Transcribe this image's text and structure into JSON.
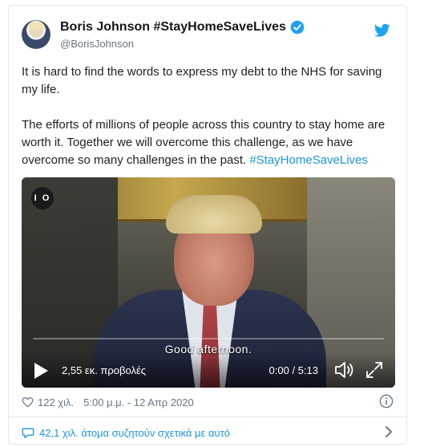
{
  "tweet": {
    "author_name": "Boris Johnson #StayHomeSaveLives",
    "handle": "@BorisJohnson",
    "paragraph1": "It is hard to find the words to express my debt to the NHS for saving my life.",
    "paragraph2_text": "The efforts of millions of people across this country to stay home are worth it. Together we will overcome this challenge, as we have overcome so many challenges in the past. ",
    "paragraph2_hashtag": "#StayHomeSaveLives"
  },
  "video": {
    "channel_logo": "I O",
    "subtitle": "Good afternoon.",
    "views": "2,55 εκ. προβολές",
    "time": "0:00 / 5:13"
  },
  "meta": {
    "likes": "122 χιλ.",
    "timestamp": "5:00 μ.μ. - 12 Απρ 2020"
  },
  "footer": {
    "discussion": "42,1 χιλ. άτομα συζητούν σχετικά με αυτό"
  },
  "colors": {
    "accent": "#1b95e0",
    "text": "#1c2022",
    "muted": "#657786",
    "border": "#e1e8ed"
  },
  "icons": [
    "avatar",
    "verified-badge-icon",
    "twitter-bird-icon",
    "play-icon",
    "volume-icon",
    "fullscreen-icon",
    "heart-icon",
    "info-icon",
    "comment-bubble-icon",
    "chevron-right-icon"
  ]
}
